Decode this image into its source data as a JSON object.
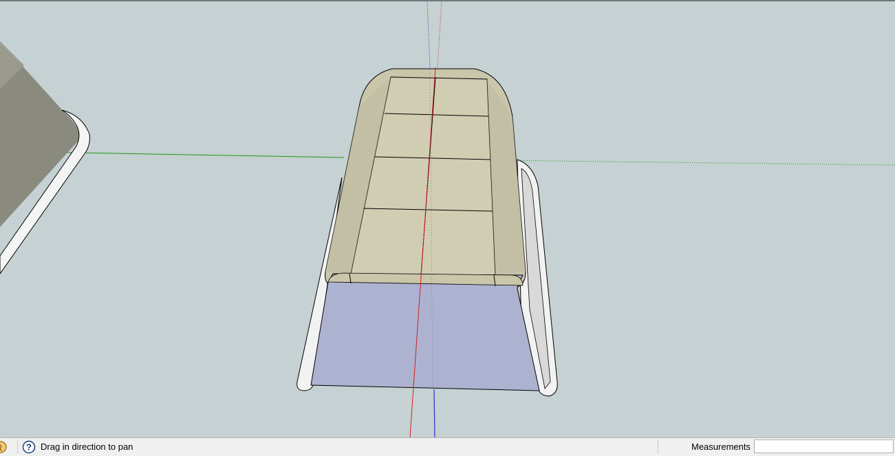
{
  "statusbar": {
    "hint": "Drag in direction to pan",
    "measurements_label": "Measurements",
    "measurements_value": ""
  },
  "icons": {
    "geo": "geo-location-icon",
    "help": "help-question-icon"
  },
  "colors": {
    "background": "#c5d1d2",
    "axis_red": "#cc2222",
    "axis_green": "#1a9a1a",
    "axis_blue": "#2233cc",
    "front_face": "#aeb2d1",
    "top_face": "#cfccb0"
  }
}
